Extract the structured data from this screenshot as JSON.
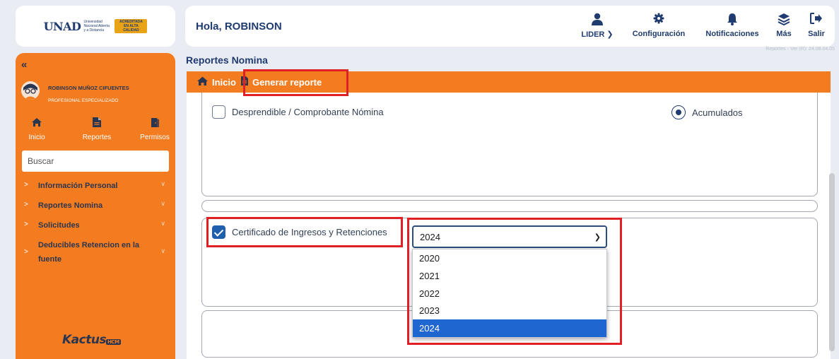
{
  "logo": {
    "brand": "UNAD",
    "subtitle": "Universidad Nacional Abierta y a Distancia",
    "accreditation": "ACREDITADA EN ALTA CALIDAD"
  },
  "sidebar": {
    "user_name": "ROBINSON MUÑOZ CIFUENTES",
    "user_role": "PROFESIONAL ESPECIALIZADO",
    "nav": [
      {
        "label": "Inicio",
        "icon": "home-icon"
      },
      {
        "label": "Reportes",
        "icon": "document-icon"
      },
      {
        "label": "Permisos",
        "icon": "door-exit-icon"
      }
    ],
    "search_placeholder": "Buscar",
    "menu": [
      {
        "label": "Información Personal"
      },
      {
        "label": "Reportes Nomina"
      },
      {
        "label": "Solicitudes"
      },
      {
        "label": "Deducibles Retencion en la fuente"
      }
    ],
    "footer_logo": "Kactus",
    "footer_logo_suffix": "HCM"
  },
  "header": {
    "greeting": "Hola, ROBINSON",
    "items": [
      {
        "label": "LIDER",
        "icon": "user-icon"
      },
      {
        "label": "Configuración",
        "icon": "gear-icon"
      },
      {
        "label": "Notificaciones",
        "icon": "bell-icon"
      },
      {
        "label": "Más",
        "icon": "layers-icon"
      },
      {
        "label": "Salir",
        "icon": "sign-out-icon"
      }
    ],
    "version": "Reportes - Ver (R): 24.08.04.05"
  },
  "main": {
    "title": "Reportes Nomina",
    "breadcrumb": [
      {
        "label": "Inicio",
        "icon": "home-icon"
      },
      {
        "label": "Generar reporte",
        "icon": "document-icon"
      }
    ],
    "options": {
      "desprendible": {
        "label": "Desprendible / Comprobante Nómina",
        "checked": false
      },
      "acumulados": {
        "label": "Acumulados",
        "selected": true
      },
      "certificado": {
        "label": "Certificado de Ingresos y Retenciones",
        "checked": true
      }
    },
    "year_select": {
      "value": "2024",
      "options": [
        "2020",
        "2021",
        "2022",
        "2023",
        "2024"
      ],
      "highlighted": "2024"
    }
  },
  "colors": {
    "accent_orange": "#f47c20",
    "navy": "#1f3b70",
    "highlight_red": "#e01f26",
    "selected_blue": "#1f66d1"
  }
}
